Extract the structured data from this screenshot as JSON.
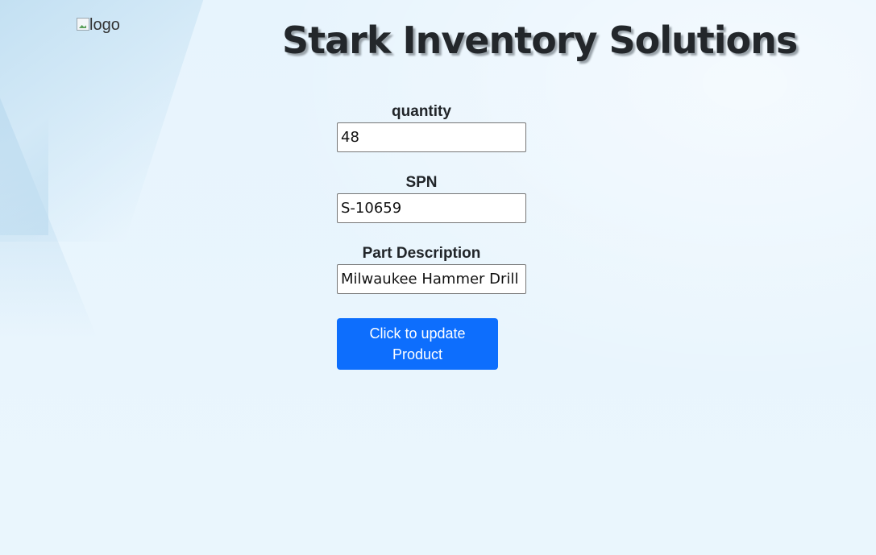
{
  "header": {
    "logo_alt": "logo",
    "title": "Stark Inventory Solutions"
  },
  "form": {
    "fields": [
      {
        "label": "quantity",
        "value": "48"
      },
      {
        "label": "SPN",
        "value": "S-10659"
      },
      {
        "label": "Part Description",
        "value": "Milwaukee Hammer Drill"
      }
    ],
    "submit_label": "Click to update Product"
  }
}
